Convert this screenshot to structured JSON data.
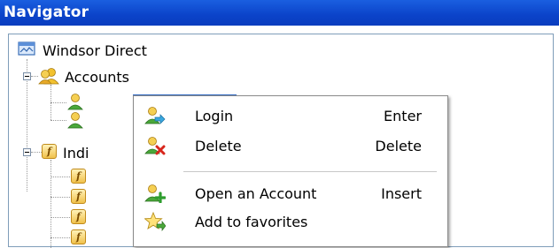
{
  "window": {
    "title": "Navigator"
  },
  "tree": {
    "root": {
      "label": "Windsor Direct",
      "icon": "network-icon"
    },
    "accounts": {
      "label": "Accounts",
      "icon": "users-group-icon",
      "expanded": true
    },
    "account_children": [
      {
        "icon": "user-icon",
        "selected": true
      },
      {
        "icon": "user-icon",
        "selected": false
      }
    ],
    "indicators": {
      "label": "Indi",
      "icon": "function-icon",
      "expanded": true
    },
    "indicator_children_count": 4
  },
  "context_menu": {
    "items": [
      {
        "label": "Login",
        "shortcut": "Enter",
        "icon": "login-icon"
      },
      {
        "label": "Delete",
        "shortcut": "Delete",
        "icon": "delete-user-icon"
      },
      {
        "label": "Open an Account",
        "shortcut": "Insert",
        "icon": "add-user-icon"
      },
      {
        "label": "Add to favorites",
        "shortcut": "",
        "icon": "favorites-star-icon"
      }
    ]
  },
  "colors": {
    "titlebar": "#0b43c9",
    "selection": "#316ac5",
    "user_icon_green": "#4aa83a",
    "user_icon_yellow": "#f2c12e"
  }
}
